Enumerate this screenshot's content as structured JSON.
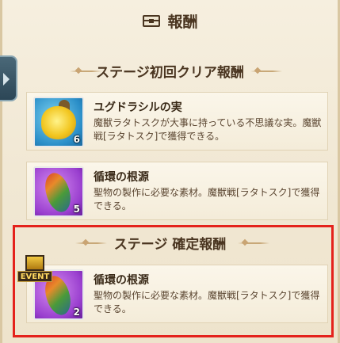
{
  "header": {
    "title": "報酬",
    "icon": "treasure-chest-icon"
  },
  "sections": [
    {
      "title": "ステージ初回クリア報酬",
      "items": [
        {
          "name": "ユグドラシルの実",
          "description": "魔獣ラタトスクが大事に持っている不思議な実。魔獣戦[ラタトスク]で獲得できる。",
          "quantity": "6",
          "icon": "golden-fruit-icon"
        },
        {
          "name": "循環の根源",
          "description": "聖物の製作に必要な素材。魔獣戦[ラタトスク]で獲得できる。",
          "quantity": "5",
          "icon": "feather-plume-icon"
        }
      ]
    },
    {
      "title": "ステージ 確定報酬",
      "items": [
        {
          "name": "循環の根源",
          "description": "聖物の製作に必要な素材。魔獣戦[ラタトスク]で獲得できる。",
          "quantity": "2",
          "icon": "feather-plume-icon",
          "badge": "EVENT"
        }
      ]
    }
  ],
  "colors": {
    "highlight": "#e4221c",
    "title": "#4a3520"
  }
}
